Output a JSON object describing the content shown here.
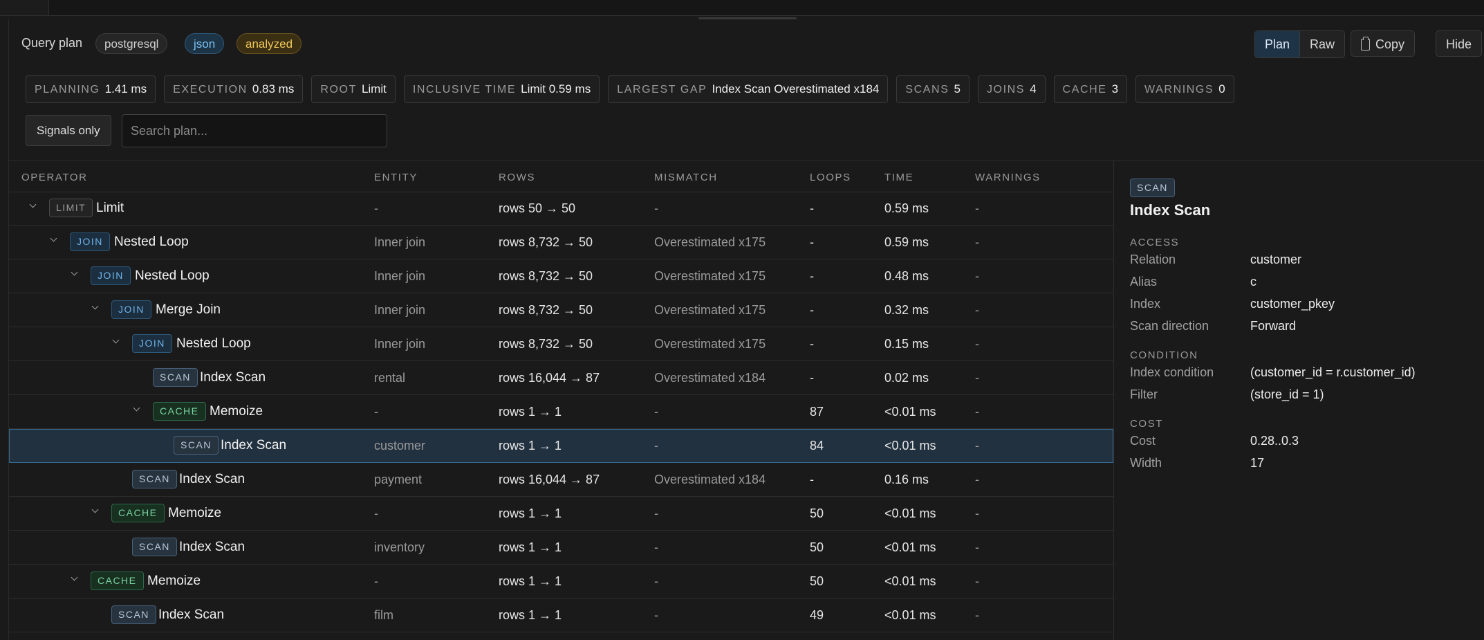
{
  "header": {
    "title": "Query plan",
    "pills": {
      "engine": "postgresql",
      "format": "json",
      "mode": "analyzed"
    },
    "view_modes": [
      "Plan",
      "Raw"
    ],
    "active_view": "Plan",
    "copy_label": "Copy",
    "hide_label": "Hide"
  },
  "stats": [
    {
      "key": "PLANNING",
      "value": "1.41 ms"
    },
    {
      "key": "EXECUTION",
      "value": "0.83 ms"
    },
    {
      "key": "ROOT",
      "value": "Limit"
    },
    {
      "key": "INCLUSIVE TIME",
      "value": "Limit 0.59 ms"
    },
    {
      "key": "LARGEST GAP",
      "value": "Index Scan Overestimated x184"
    },
    {
      "key": "SCANS",
      "value": "5"
    },
    {
      "key": "JOINS",
      "value": "4"
    },
    {
      "key": "CACHE",
      "value": "3"
    },
    {
      "key": "WARNINGS",
      "value": "0"
    }
  ],
  "filters": {
    "signals_only_label": "Signals only",
    "search_placeholder": "Search plan..."
  },
  "table": {
    "columns": [
      "OPERATOR",
      "ENTITY",
      "ROWS",
      "MISMATCH",
      "LOOPS",
      "TIME",
      "WARNINGS"
    ],
    "rows": [
      {
        "depth": 0,
        "expandable": true,
        "badge": "LIMIT",
        "kind": "limit",
        "name": "Limit",
        "entity": "-",
        "rows": "rows 50 → 50",
        "mismatch": "-",
        "loops": "-",
        "time": "0.59 ms",
        "warnings": "-"
      },
      {
        "depth": 1,
        "expandable": true,
        "badge": "JOIN",
        "kind": "join",
        "name": "Nested Loop",
        "entity": "Inner join",
        "rows": "rows 8,732 → 50",
        "mismatch": "Overestimated x175",
        "loops": "-",
        "time": "0.59 ms",
        "warnings": "-"
      },
      {
        "depth": 2,
        "expandable": true,
        "badge": "JOIN",
        "kind": "join",
        "name": "Nested Loop",
        "entity": "Inner join",
        "rows": "rows 8,732 → 50",
        "mismatch": "Overestimated x175",
        "loops": "-",
        "time": "0.48 ms",
        "warnings": "-"
      },
      {
        "depth": 3,
        "expandable": true,
        "badge": "JOIN",
        "kind": "join",
        "name": "Merge Join",
        "entity": "Inner join",
        "rows": "rows 8,732 → 50",
        "mismatch": "Overestimated x175",
        "loops": "-",
        "time": "0.32 ms",
        "warnings": "-"
      },
      {
        "depth": 4,
        "expandable": true,
        "badge": "JOIN",
        "kind": "join",
        "name": "Nested Loop",
        "entity": "Inner join",
        "rows": "rows 8,732 → 50",
        "mismatch": "Overestimated x175",
        "loops": "-",
        "time": "0.15 ms",
        "warnings": "-"
      },
      {
        "depth": 5,
        "expandable": false,
        "badge": "SCAN",
        "kind": "scan",
        "name": "Index Scan",
        "entity": "rental",
        "rows": "rows 16,044 → 87",
        "mismatch": "Overestimated x184",
        "loops": "-",
        "time": "0.02 ms",
        "warnings": "-"
      },
      {
        "depth": 5,
        "expandable": true,
        "badge": "CACHE",
        "kind": "cache",
        "name": "Memoize",
        "entity": "-",
        "rows": "rows 1 → 1",
        "mismatch": "-",
        "loops": "87",
        "time": "<0.01 ms",
        "warnings": "-"
      },
      {
        "depth": 6,
        "expandable": false,
        "badge": "SCAN",
        "kind": "scan",
        "name": "Index Scan",
        "entity": "customer",
        "rows": "rows 1 → 1",
        "mismatch": "-",
        "loops": "84",
        "time": "<0.01 ms",
        "warnings": "-",
        "selected": true
      },
      {
        "depth": 4,
        "expandable": false,
        "badge": "SCAN",
        "kind": "scan",
        "name": "Index Scan",
        "entity": "payment",
        "rows": "rows 16,044 → 87",
        "mismatch": "Overestimated x184",
        "loops": "-",
        "time": "0.16 ms",
        "warnings": "-"
      },
      {
        "depth": 3,
        "expandable": true,
        "badge": "CACHE",
        "kind": "cache",
        "name": "Memoize",
        "entity": "-",
        "rows": "rows 1 → 1",
        "mismatch": "-",
        "loops": "50",
        "time": "<0.01 ms",
        "warnings": "-"
      },
      {
        "depth": 4,
        "expandable": false,
        "badge": "SCAN",
        "kind": "scan",
        "name": "Index Scan",
        "entity": "inventory",
        "rows": "rows 1 → 1",
        "mismatch": "-",
        "loops": "50",
        "time": "<0.01 ms",
        "warnings": "-"
      },
      {
        "depth": 2,
        "expandable": true,
        "badge": "CACHE",
        "kind": "cache",
        "name": "Memoize",
        "entity": "-",
        "rows": "rows 1 → 1",
        "mismatch": "-",
        "loops": "50",
        "time": "<0.01 ms",
        "warnings": "-"
      },
      {
        "depth": 3,
        "expandable": false,
        "badge": "SCAN",
        "kind": "scan",
        "name": "Index Scan",
        "entity": "film",
        "rows": "rows 1 → 1",
        "mismatch": "-",
        "loops": "49",
        "time": "<0.01 ms",
        "warnings": "-"
      }
    ]
  },
  "detail": {
    "badge": "SCAN",
    "title": "Index Scan",
    "sections": [
      {
        "heading": "ACCESS",
        "items": [
          {
            "key": "Relation",
            "value": "customer"
          },
          {
            "key": "Alias",
            "value": "c"
          },
          {
            "key": "Index",
            "value": "customer_pkey"
          },
          {
            "key": "Scan direction",
            "value": "Forward"
          }
        ]
      },
      {
        "heading": "CONDITION",
        "items": [
          {
            "key": "Index condition",
            "value": "(customer_id = r.customer_id)"
          },
          {
            "key": "Filter",
            "value": "(store_id = 1)"
          }
        ]
      },
      {
        "heading": "COST",
        "items": [
          {
            "key": "Cost",
            "value": "0.28..0.3"
          },
          {
            "key": "Width",
            "value": "17"
          }
        ]
      }
    ]
  }
}
